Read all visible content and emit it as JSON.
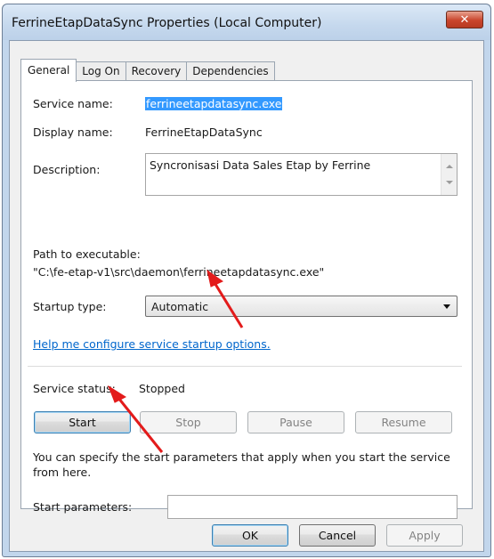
{
  "window": {
    "title": "FerrineEtapDataSync Properties (Local Computer)",
    "close_label": "✕"
  },
  "tabs": [
    {
      "label": "General",
      "active": true
    },
    {
      "label": "Log On",
      "active": false
    },
    {
      "label": "Recovery",
      "active": false
    },
    {
      "label": "Dependencies",
      "active": false
    }
  ],
  "general": {
    "service_name_label": "Service name:",
    "service_name_value": "ferrineetapdatasync.exe",
    "display_name_label": "Display name:",
    "display_name_value": "FerrineEtapDataSync",
    "description_label": "Description:",
    "description_value": "Syncronisasi Data Sales Etap by Ferrine",
    "path_label": "Path to executable:",
    "path_value": "\"C:\\fe-etap-v1\\src\\daemon\\ferrineetapdatasync.exe\"",
    "startup_type_label": "Startup type:",
    "startup_type_value": "Automatic",
    "help_link": "Help me configure service startup options.",
    "status_label": "Service status:",
    "status_value": "Stopped",
    "buttons": {
      "start": "Start",
      "stop": "Stop",
      "pause": "Pause",
      "resume": "Resume"
    },
    "hint_line1": "You can specify the start parameters that apply when you start the service",
    "hint_line2": "from here.",
    "start_params_label": "Start parameters:",
    "start_params_value": ""
  },
  "footer": {
    "ok": "OK",
    "cancel": "Cancel",
    "apply": "Apply"
  },
  "colors": {
    "annotation_arrow": "#e31b1b",
    "selection": "#3399ff",
    "link": "#0066cc"
  }
}
